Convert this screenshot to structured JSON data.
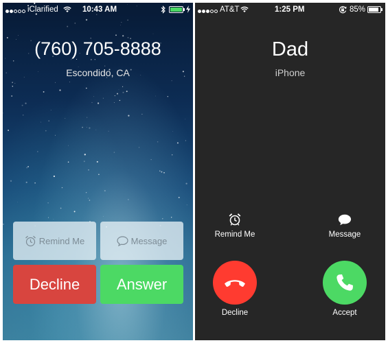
{
  "left": {
    "status": {
      "carrier": "iClarified",
      "time": "10:43 AM"
    },
    "caller": {
      "number": "(760) 705-8888",
      "location": "Escondido, CA"
    },
    "buttons": {
      "remind": "Remind Me",
      "message": "Message",
      "decline": "Decline",
      "answer": "Answer"
    },
    "colors": {
      "decline": "#d8453f",
      "answer": "#4cd964",
      "battery": "#4cd964"
    }
  },
  "right": {
    "status": {
      "carrier": "AT&T",
      "time": "1:25 PM",
      "battery": "85%"
    },
    "caller": {
      "name": "Dad",
      "device": "iPhone"
    },
    "buttons": {
      "remind": "Remind Me",
      "message": "Message",
      "decline": "Decline",
      "accept": "Accept"
    },
    "colors": {
      "decline": "#ff3b30",
      "accept": "#4cd964"
    }
  },
  "icons": [
    "wifi-icon",
    "bluetooth-icon",
    "battery-icon",
    "charging-bolt-icon",
    "alarm-clock-icon",
    "speech-bubble-icon",
    "phone-hangup-icon",
    "phone-icon",
    "rotation-lock-icon"
  ]
}
